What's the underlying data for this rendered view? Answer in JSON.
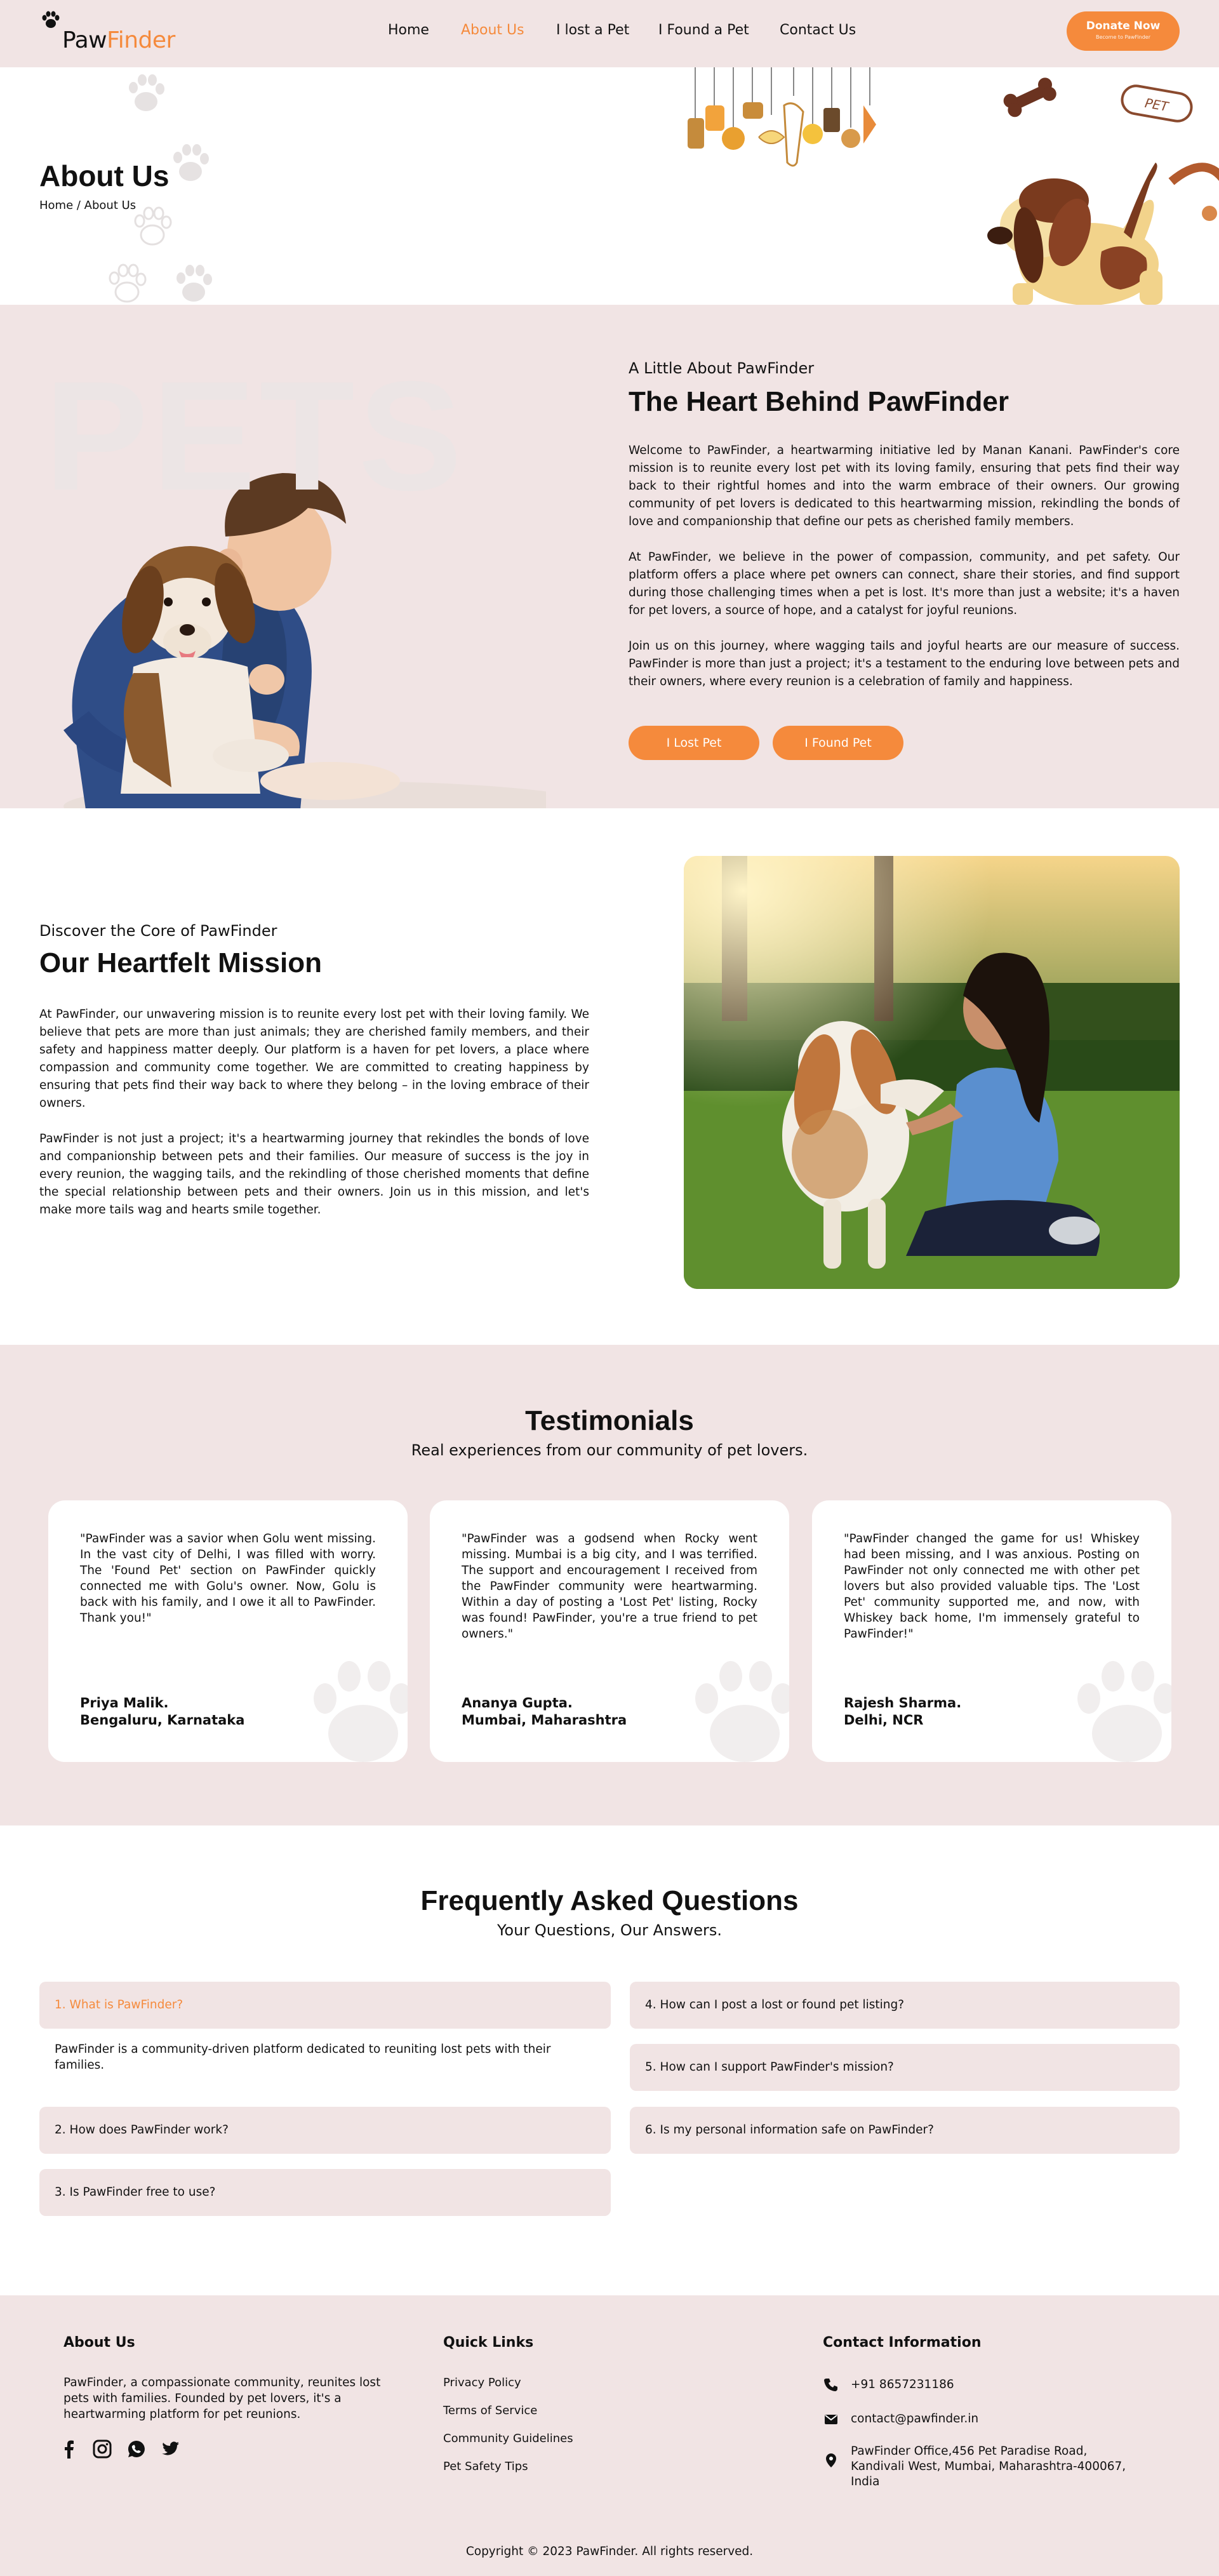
{
  "brand": {
    "name_part1": "Paw",
    "name_part2": "Finder"
  },
  "nav": {
    "items": [
      {
        "label": "Home"
      },
      {
        "label": "About Us",
        "active": true
      },
      {
        "label": "I lost a Pet"
      },
      {
        "label": "I Found a Pet"
      },
      {
        "label": "Contact Us"
      }
    ],
    "donate": {
      "label": "Donate Now",
      "sublabel": "Become to PawFinder"
    }
  },
  "hero": {
    "title": "About Us",
    "breadcrumb": "Home / About Us",
    "collar_tag_text": "PET"
  },
  "about": {
    "watermark": "PETS",
    "eyebrow": "A Little About PawFinder",
    "title": "The Heart Behind PawFinder",
    "paragraphs": [
      "Welcome to PawFinder, a heartwarming initiative led by Manan Kanani. PawFinder's core mission is to reunite every lost pet with its loving family, ensuring that pets find their way back to their rightful homes and into the warm embrace of their owners. Our growing community of pet lovers is dedicated to this heartwarming mission, rekindling the bonds of love and companionship that define our pets as cherished family members.",
      "At PawFinder, we believe in the power of compassion, community, and pet safety. Our platform offers a place where pet owners can connect, share their stories, and find support during those challenging times when a pet is lost. It's more than just a website; it's a haven for pet lovers, a source of hope, and a catalyst for joyful reunions.",
      "Join us on this journey, where wagging tails and joyful hearts are our measure of success. PawFinder is more than just a project; it's a testament to the enduring love between pets and their owners, where every reunion is a celebration of family and happiness."
    ],
    "buttons": {
      "lost": "I Lost Pet",
      "found": "I Found Pet"
    }
  },
  "mission": {
    "eyebrow": "Discover the Core of PawFinder",
    "title": "Our Heartfelt Mission",
    "paragraphs": [
      "At PawFinder, our unwavering mission is to reunite every lost pet with their loving family. We believe that pets are more than just animals; they are cherished family members, and their safety and happiness matter deeply. Our platform is a haven for pet lovers, a place where compassion and community come together. We are committed to creating happiness by ensuring that pets find their way back to where they belong – in the loving embrace of their owners.",
      "PawFinder is not just a project; it's a heartwarming journey that rekindles the bonds of love and companionship between pets and their families. Our measure of success is the joy in every reunion, the wagging tails, and the rekindling of those cherished moments that define the special relationship between pets and their owners. Join us in this mission, and let's make more tails wag and hearts smile together."
    ]
  },
  "testimonials": {
    "title": "Testimonials",
    "subtitle": "Real experiences from our community of pet lovers.",
    "items": [
      {
        "quote": "\"PawFinder was a savior when Golu went missing. In the vast city of Delhi, I was filled with worry. The 'Found Pet' section on PawFinder quickly connected me with Golu's owner. Now, Golu is back with his family, and I owe it all to PawFinder. Thank you!\"",
        "name": "Priya Malik.",
        "location": "Bengaluru, Karnataka"
      },
      {
        "quote": "\"PawFinder was a godsend when Rocky went missing. Mumbai is a big city, and I was terrified. The support and encouragement I received from the PawFinder community were heartwarming. Within a day of posting a 'Lost Pet' listing, Rocky was found! PawFinder, you're a true friend to pet owners.\"",
        "name": "Ananya Gupta.",
        "location": "Mumbai, Maharashtra"
      },
      {
        "quote": "\"PawFinder changed the game for us! Whiskey had been missing, and I was anxious. Posting on PawFinder not only connected me with other pet lovers but also provided valuable tips. The 'Lost Pet' community supported me, and now, with Whiskey back home, I'm immensely grateful to PawFinder!\"",
        "name": "Rajesh Sharma.",
        "location": "Delhi, NCR"
      }
    ]
  },
  "faq": {
    "title": "Frequently Asked Questions",
    "subtitle": "Your Questions, Our Answers.",
    "items": [
      {
        "q": "1. What is PawFinder?",
        "open": true,
        "a": "PawFinder is a community-driven platform dedicated to reuniting lost pets with their families."
      },
      {
        "q": "2. How does PawFinder work?"
      },
      {
        "q": "3. Is PawFinder free to use?"
      },
      {
        "q": "4. How can I post a lost or found pet listing?"
      },
      {
        "q": "5. How can I support PawFinder's mission?"
      },
      {
        "q": "6. Is my personal information safe on PawFinder?"
      }
    ]
  },
  "footer": {
    "about_title": "About Us",
    "about_text": "PawFinder, a compassionate community, reunites lost pets with families. Founded by pet lovers, it's a heartwarming platform for pet reunions.",
    "social_icons": [
      "facebook-icon",
      "instagram-icon",
      "whatsapp-icon",
      "twitter-icon"
    ],
    "links_title": "Quick Links",
    "links": [
      "Privacy Policy",
      "Terms of Service",
      "Community Guidelines",
      "Pet Safety Tips"
    ],
    "contact_title": "Contact Information",
    "phone": "+91 8657231186",
    "email": "contact@pawfinder.in",
    "address": "PawFinder Office,456 Pet Paradise Road, Kandivali West, Mumbai, Maharashtra-400067, India",
    "copyright": "Copyright © 2023 PawFinder. All rights reserved."
  },
  "colors": {
    "accent": "#f58a3c",
    "section_bg": "#f1e4e4",
    "text": "#111111",
    "white": "#ffffff"
  }
}
